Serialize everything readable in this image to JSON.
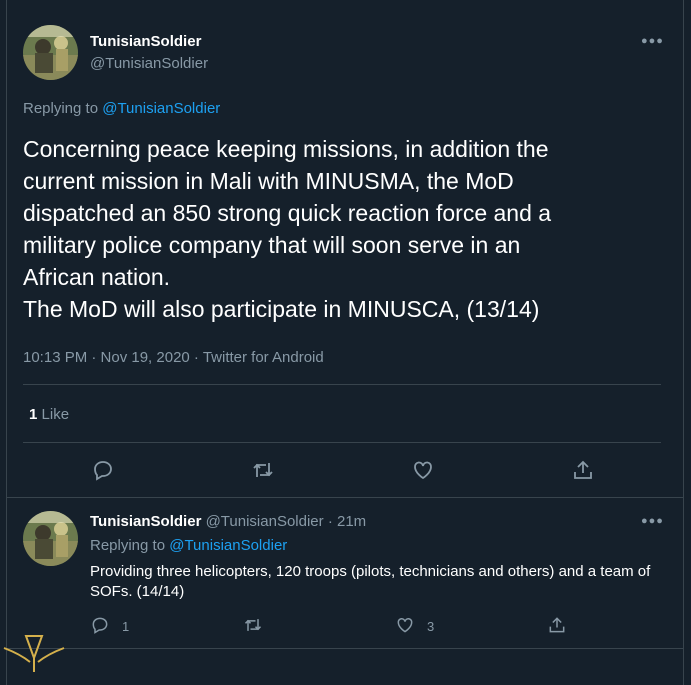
{
  "main_tweet": {
    "author_name": "TunisianSoldier",
    "author_handle": "@TunisianSoldier",
    "replying_prefix": "Replying to ",
    "replying_to": "@TunisianSoldier",
    "text": "Concerning peace keeping missions, in addition the\ncurrent mission in Mali with MINUSMA, the MoD\ndispatched an 850 strong quick reaction force and a\nmilitary police company that will soon serve in an\nAfrican nation.\nThe MoD will also participate in MINUSCA, (13/14)",
    "timestamp": "10:13 PM · Nov 19, 2020 · Twitter for Android",
    "like_count": "1",
    "like_label": "Like",
    "more_icon": "more-icon"
  },
  "reply_tweet": {
    "author_name": "TunisianSoldier",
    "author_handle": "@TunisianSoldier",
    "time": "· 21m",
    "replying_prefix": "Replying to ",
    "replying_to": "@TunisianSoldier",
    "text": "Providing three helicopters, 120 troops (pilots, technicians and others) and a team of SOFs. (14/14)",
    "reply_count": "1",
    "like_count": "3"
  },
  "colors": {
    "background": "#15202b",
    "secondary_text": "#8899a6",
    "link": "#1da1f2",
    "divider": "#38444d"
  }
}
